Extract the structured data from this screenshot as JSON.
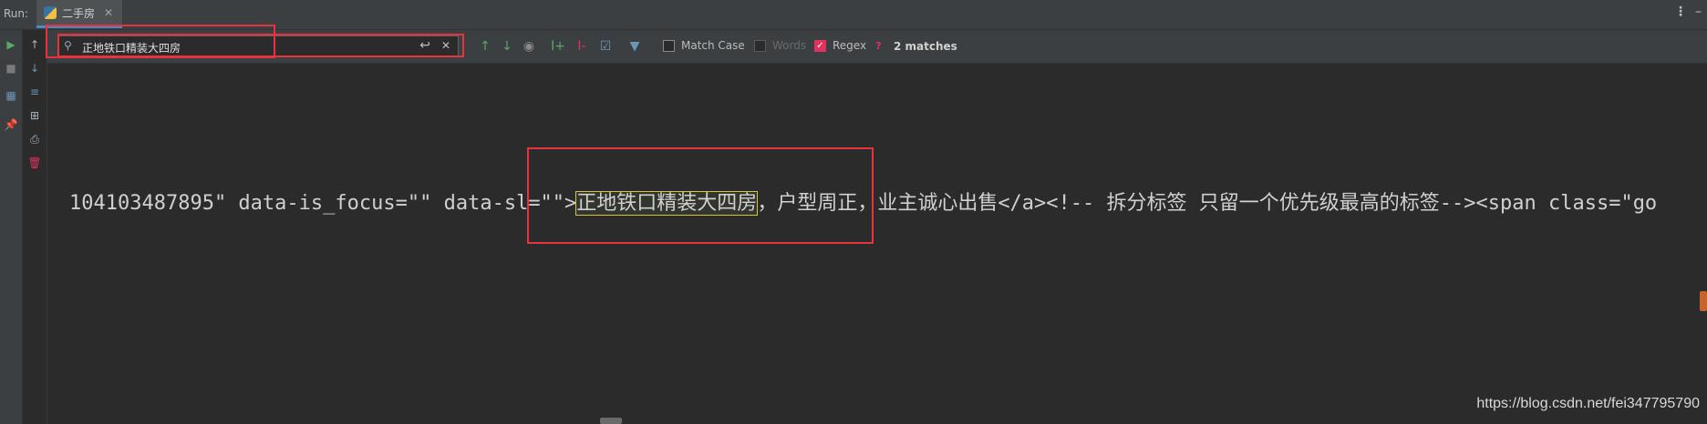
{
  "run_panel": {
    "label": "Run:",
    "tab_title": "二手房"
  },
  "find": {
    "query": "正地铁口精装大四房",
    "match_case_label": "Match Case",
    "words_label": "Words",
    "regex_label": "Regex",
    "help": "?",
    "matches": "2 matches",
    "match_case": false,
    "words": false,
    "regex": true
  },
  "console": {
    "before": "104103487895\" data-is_focus=\"\" data-sl=\"\">",
    "match": "正地铁口精装大四房",
    "after": "，户型周正，业主诚心出售</a><!-- 拆分标签 只留一个优先级最高的标签--><span class=\"go"
  },
  "watermark": "https://blog.csdn.net/fei347795790",
  "colors": {
    "highlight_border": "#d6c43a",
    "annotation_red": "#e8333c",
    "regex_check": "#e0325a"
  }
}
